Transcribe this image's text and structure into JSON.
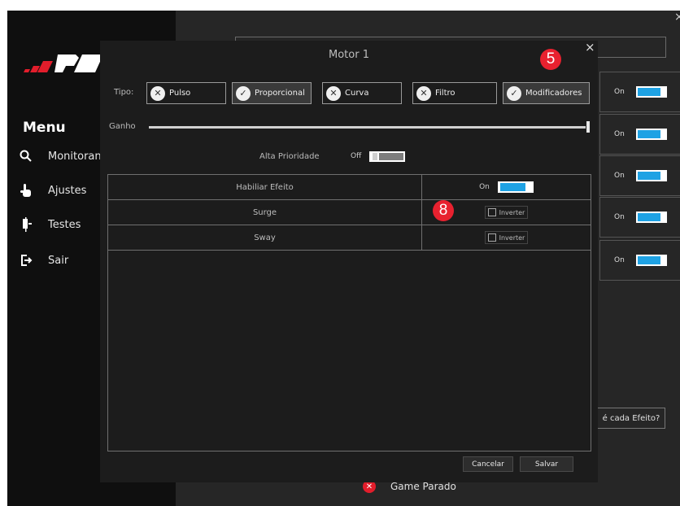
{
  "app": {
    "close_glyph": "×",
    "menu": {
      "title": "Menu",
      "items": [
        {
          "label": "Monitoran",
          "icon": "search-icon"
        },
        {
          "label": "Ajustes",
          "icon": "hand-pointer-icon"
        },
        {
          "label": "Testes",
          "icon": "plug-icon"
        },
        {
          "label": "Sair",
          "icon": "exit-icon"
        }
      ]
    },
    "background_rows": [
      {
        "label": "On"
      },
      {
        "label": "On"
      },
      {
        "label": "On"
      },
      {
        "label": "On"
      },
      {
        "label": "On"
      }
    ],
    "efeito_button": "é cada Efeito?",
    "game_status": "Game Parado"
  },
  "modal": {
    "title": "Motor 1",
    "close_glyph": "×",
    "marker_5": "5",
    "marker_8": "8",
    "tipo_label": "Tipo:",
    "types": [
      {
        "label": "Pulso",
        "state": "x"
      },
      {
        "label": "Proporcional",
        "state": "check"
      },
      {
        "label": "Curva",
        "state": "x"
      },
      {
        "label": "Filtro",
        "state": "x"
      },
      {
        "label": "Modificadores",
        "state": "check"
      }
    ],
    "ganho_label": "Ganho",
    "ganho_value": 1.0,
    "alta_prioridade_label": "Alta Prioridade",
    "alta_prioridade_state": "Off",
    "effects": [
      {
        "name": "Habiliar Efeito",
        "control": "toggle",
        "state": "On"
      },
      {
        "name": "Surge",
        "control": "checkbox",
        "label": "Inverter",
        "checked": false
      },
      {
        "name": "Sway",
        "control": "checkbox",
        "label": "Inverter",
        "checked": false
      }
    ],
    "cancel_label": "Cancelar",
    "save_label": "Salvar"
  },
  "colors": {
    "accent_blue": "#1ea2e4",
    "marker_red": "#e8212f",
    "logo_red": "#e21d2b"
  }
}
